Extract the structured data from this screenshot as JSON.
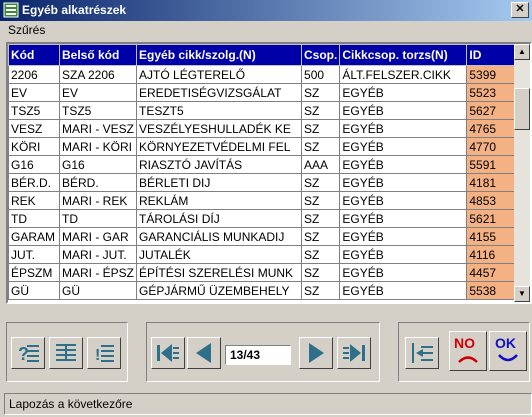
{
  "window": {
    "title": "Egyéb alkatrészek",
    "close_label": "✕"
  },
  "menu": {
    "items": [
      "Szűrés"
    ]
  },
  "grid": {
    "columns": [
      "Kód",
      "Belső kód",
      "Egyéb cikk/szolg.(N)",
      "Csop.",
      "Cikkcsop. torzs(N)",
      "ID"
    ],
    "rows": [
      [
        "2206",
        "SZA 2206",
        "AJTÓ LÉGTERELŐ",
        "500",
        "ÁLT.FELSZER.CIKK",
        "5399"
      ],
      [
        "EV",
        "EV",
        "EREDETISÉGVIZSGÁLAT",
        "SZ",
        "EGYÉB",
        "5523"
      ],
      [
        "TSZ5",
        "TSZ5",
        "TESZT5",
        "SZ",
        "EGYÉB",
        "5627"
      ],
      [
        "VESZ",
        "MARI - VESZ",
        "VESZÉLYESHULLADÉK KE",
        "SZ",
        "EGYÉB",
        "4765"
      ],
      [
        "KÖRI",
        "MARI - KÖRI",
        "KÖRNYEZETVÉDELMI FEL",
        "SZ",
        "EGYÉB",
        "4770"
      ],
      [
        "G16",
        "G16",
        "RIASZTÓ JAVÍTÁS",
        "AAA",
        "EGYÉB",
        "5591"
      ],
      [
        "BÉR.D.",
        "BÉRD.",
        "BÉRLETI DIJ",
        "SZ",
        "EGYÉB",
        "4181"
      ],
      [
        "REK",
        "MARI - REK",
        "REKLÁM",
        "SZ",
        "EGYÉB",
        "4853"
      ],
      [
        "TD",
        "TD",
        "TÁROLÁSI DÍJ",
        "SZ",
        "EGYÉB",
        "5621"
      ],
      [
        "GARAM",
        "MARI - GAR",
        "GARANCIÁLIS MUNKADIJ",
        "SZ",
        "EGYÉB",
        "4155"
      ],
      [
        "JUT.",
        "MARI - JUT.",
        "JUTALÉK",
        "SZ",
        "EGYÉB",
        "4116"
      ],
      [
        "ÉPSZM",
        "MARI - ÉPSZ",
        "ÉPÍTÉSI SZERELÉSI MUNK",
        "SZ",
        "EGYÉB",
        "4457"
      ],
      [
        "GÜ",
        "GÜ",
        "GÉPJÁRMŰ ÜZEMBEHELY",
        "SZ",
        "EGYÉB",
        "5538"
      ]
    ]
  },
  "pager": {
    "value": "13/43"
  },
  "buttons": {
    "no_label": "NO",
    "ok_label": "OK"
  },
  "status": {
    "text": "Lapozás a következőre"
  },
  "colors": {
    "header_bg": "#0000a8",
    "id_bg": "#f4b183",
    "accent": "#0a246a",
    "nav_icon": "#2e6f8a",
    "no_red": "#d00000",
    "ok_blue": "#1010c0"
  }
}
